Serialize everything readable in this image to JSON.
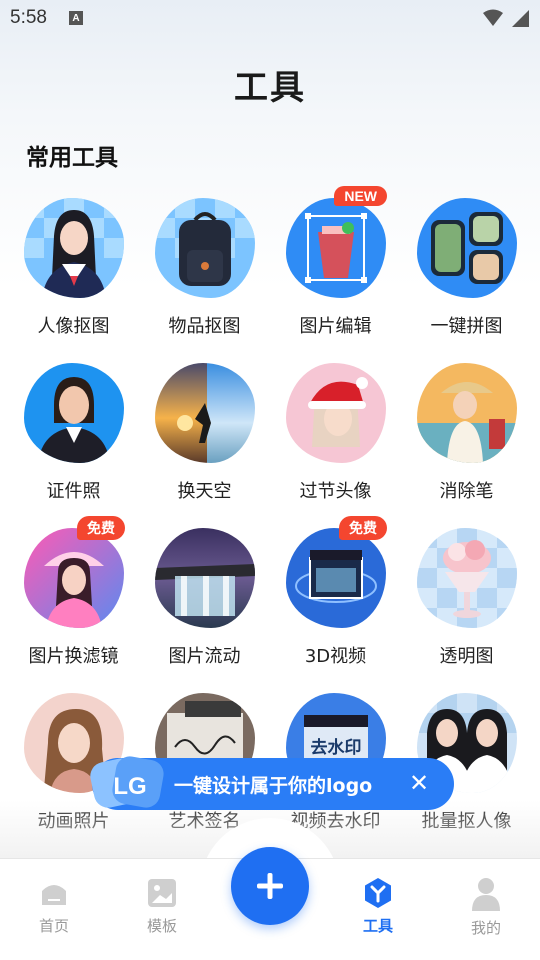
{
  "status_bar": {
    "time": "5:58",
    "notif_icon": "A"
  },
  "header": {
    "title": "工具"
  },
  "section": {
    "title": "常用工具"
  },
  "tools": [
    {
      "label": "人像抠图",
      "icon": "portrait-cutout",
      "badge": ""
    },
    {
      "label": "物品抠图",
      "icon": "backpack-cutout",
      "badge": ""
    },
    {
      "label": "图片编辑",
      "icon": "photo-edit",
      "badge": "NEW"
    },
    {
      "label": "一键拼图",
      "icon": "collage",
      "badge": ""
    },
    {
      "label": "证件照",
      "icon": "id-photo",
      "badge": ""
    },
    {
      "label": "换天空",
      "icon": "sky-replace",
      "badge": ""
    },
    {
      "label": "过节头像",
      "icon": "holiday-avatar",
      "badge": ""
    },
    {
      "label": "消除笔",
      "icon": "eraser-pen",
      "badge": ""
    },
    {
      "label": "图片换滤镜",
      "icon": "filter-change",
      "badge": "免费"
    },
    {
      "label": "图片流动",
      "icon": "image-flow",
      "badge": ""
    },
    {
      "label": "3D视频",
      "icon": "3d-video",
      "badge": "免费"
    },
    {
      "label": "透明图",
      "icon": "transparent-image",
      "badge": ""
    },
    {
      "label": "动画照片",
      "icon": "animated-photo",
      "badge": ""
    },
    {
      "label": "艺术签名",
      "icon": "art-signature",
      "badge": ""
    },
    {
      "label": "视频去水印",
      "icon": "video-watermark-remove",
      "badge": ""
    },
    {
      "label": "批量抠人像",
      "icon": "batch-portrait-cutout",
      "badge": ""
    }
  ],
  "tile_art": {
    "watermark_text": "去水印"
  },
  "banner": {
    "text": "一键设计属于你的logo",
    "close": "✕",
    "logo_text": "LG"
  },
  "tabs": [
    {
      "label": "首页",
      "icon": "home-icon",
      "active": false
    },
    {
      "label": "模板",
      "icon": "template-icon",
      "active": false
    },
    {
      "label": "工具",
      "icon": "tools-icon",
      "active": true
    },
    {
      "label": "我的",
      "icon": "profile-icon",
      "active": false
    }
  ],
  "fab": {
    "icon": "plus-icon"
  },
  "colors": {
    "accent": "#1f6ff2",
    "badge": "#f4462f",
    "banner": "#2a7df6"
  }
}
